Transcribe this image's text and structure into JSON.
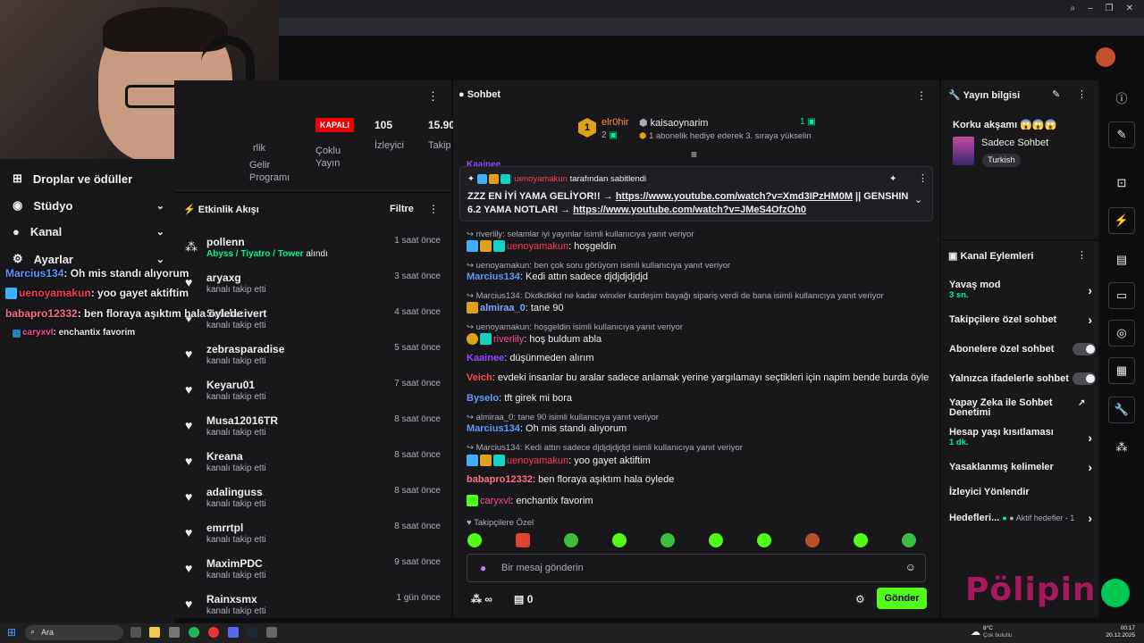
{
  "stats": {
    "items": [
      {
        "value": "",
        "label1": "rlik",
        "label2": ""
      },
      {
        "badge": "KAPALI",
        "label1": "Çoklu",
        "label2": "Yayın"
      },
      {
        "value": "105",
        "label1": "İzleyici",
        "label2": ""
      },
      {
        "value": "15.90",
        "label1": "Takip",
        "label2": ""
      }
    ],
    "gelir_label1": "Gelir",
    "gelir_label2": "Programı"
  },
  "left_menu": [
    {
      "label": "Droplar ve ödüller",
      "icon": "gift-icon"
    },
    {
      "label": "Stüdyo",
      "icon": "camera-icon"
    },
    {
      "label": "Kanal",
      "icon": "user-icon"
    },
    {
      "label": "Ayarlar",
      "icon": "gear-icon"
    }
  ],
  "overlay_chat": [
    {
      "user": "Marcius134",
      "text": ": Oh mis standı alıyorum",
      "color": "#5b9bff"
    },
    {
      "user": "uenoyamakun",
      "text": ": yoo gayet aktiftim",
      "color": "#ff3c5a"
    },
    {
      "user": "babapro12332",
      "text": ": ben floraya aşıktım hala öylede",
      "color": "#ff6e8a"
    },
    {
      "user": "caryxvl",
      "text": ": enchantix favorim",
      "color": "#ff4aa5"
    }
  ],
  "activity": {
    "title": "Etkinlik Akışı",
    "filter_label": "Filtre",
    "rows": [
      {
        "name": "pollenn",
        "sub": "Abyss / Tiyatro / Tower",
        "sub_suffix": " alındı",
        "time": "1 saat önce"
      },
      {
        "name": "aryaxg",
        "sub": "kanalı takip etti",
        "time": "3 saat önce"
      },
      {
        "name": "Sefalacivert",
        "sub": "kanalı takip etti",
        "time": "4 saat önce"
      },
      {
        "name": "zebrasparadise",
        "sub": "kanalı takip etti",
        "time": "5 saat önce"
      },
      {
        "name": "Keyaru01",
        "sub": "kanalı takip etti",
        "time": "7 saat önce"
      },
      {
        "name": "Musa12016TR",
        "sub": "kanalı takip etti",
        "time": "8 saat önce"
      },
      {
        "name": "Kreana",
        "sub": "kanalı takip etti",
        "time": "8 saat önce"
      },
      {
        "name": "adalinguss",
        "sub": "kanalı takip etti",
        "time": "8 saat önce"
      },
      {
        "name": "emrrtpl",
        "sub": "kanalı takip etti",
        "time": "8 saat önce"
      },
      {
        "name": "MaximPDC",
        "sub": "kanalı takip etti",
        "time": "9 saat önce"
      },
      {
        "name": "Rainxsmx",
        "sub": "kanalı takip etti",
        "time": "1 gün önce"
      }
    ]
  },
  "chat": {
    "title": "Sohbet",
    "leader": {
      "rank": "1",
      "user": "elr0hir",
      "count": "2",
      "gifter": "kaisaoynarim",
      "gift_count": "1",
      "gift_text": "1 abonelik hediye ederek 3. sıraya yükselin"
    },
    "partial_user": "Kaainee",
    "pinned": {
      "by_user": "uenoyamakun",
      "by_text": "tarafından sabitlendi",
      "text1": "ZZZ EN İYİ YAMA GELİYOR!! → ",
      "link1": "https://www.youtube.com/watch?v=Xmd3IPzHM0M",
      "text2": " || GENSHIN",
      "text3": "6.2 YAMA NOTLARI → ",
      "link2": "https://www.youtube.com/watch?v=JMeS4OfzOh0"
    },
    "messages": [
      {
        "reply": "riverlily: selamlar iyi yayınlar isimli kullanıcıya yanıt veriyor",
        "user": "uenoyamakun",
        "color": "#ff3c5a",
        "text": ": hoşgeldin",
        "badges": 3
      },
      {
        "reply": "uenoyamakun: ben çok soru görüyom isimli kullanıcıya yanıt veriyor",
        "user": "Marcius134",
        "color": "#5b9bff",
        "text": ": Kedi attın sadece djdjdjdjdjd",
        "badges": 0
      },
      {
        "reply": "Marcius134: Dkdkdkkd ne kadar winxler kardeşim bayağı sipariş verdi de bana isimli kullanıcıya yanıt veriyor",
        "user": "almiraa_0",
        "color": "#7fa7ff",
        "text": ": tane 90",
        "badges": 1
      },
      {
        "reply": "uenoyamakun: hoşgeldin isimli kullanıcıya yanıt veriyor",
        "user": "riverlily",
        "color": "#ff4aa5",
        "text": ": hoş buldum abla",
        "badges": 2
      },
      {
        "reply": "",
        "user": "Kaainee",
        "color": "#9147ff",
        "text": ": düşünmeden alırım",
        "badges": 0
      },
      {
        "reply": "",
        "user": "Veich",
        "color": "#ff4a4a",
        "text": ": evdeki insanlar bu aralar sadece anlamak yerine yargılamayı seçtikleri için napim bende burda öyle",
        "badges": 0
      },
      {
        "reply": "",
        "user": "Byselo",
        "color": "#5b9bff",
        "text": ": tft girek mi bora",
        "badges": 0
      },
      {
        "reply": "almiraa_0: tane 90 isimli kullanıcıya yanıt veriyor",
        "user": "Marcius134",
        "color": "#5b9bff",
        "text": ": Oh mis standı alıyorum",
        "badges": 0
      },
      {
        "reply": "Marcius134: Kedi attın sadece djdjdjdjdjd isimli kullanıcıya yanıt veriyor",
        "user": "uenoyamakun",
        "color": "#ff3c5a",
        "text": ": yoo gayet aktiftim",
        "badges": 3
      },
      {
        "reply": "",
        "user": "babapro12332",
        "color": "#ff6e8a",
        "text": ": ben floraya aşıktım hala öylede",
        "badges": 0
      },
      {
        "reply": "",
        "user": "caryxvl",
        "color": "#ff4aa5",
        "text": ": enchantix favorim",
        "badges": 1
      }
    ],
    "emote_label": "Takipçilere Özel",
    "input_placeholder": "Bir mesaj gönderin",
    "points": "∞",
    "sub_count": "0",
    "send_label": "Gönder"
  },
  "stream_info": {
    "title": "Yayın bilgisi",
    "stream_title": "Korku akşamı 😱😱😱",
    "category": "Sadece Sohbet",
    "tag": "Turkish"
  },
  "channel_actions": {
    "title": "Kanal Eylemleri",
    "rows": [
      {
        "label": "Yavaş mod",
        "sub": "3 sn.",
        "control": "chevron"
      },
      {
        "label": "Takipçilere özel sohbet",
        "sub": "",
        "control": "chevron"
      },
      {
        "label": "Abonelere özel sohbet",
        "sub": "",
        "control": "toggle"
      },
      {
        "label": "Yalnızca ifadelerle sohbet",
        "sub": "",
        "control": "toggle"
      },
      {
        "label": "Yapay Zeka ile Sohbet Denetimi",
        "sub": "",
        "control": "external"
      },
      {
        "label": "Hesap yaşı kısıtlaması",
        "sub": "1 dk.",
        "control": "chevron"
      },
      {
        "label": "Yasaklanmış kelimeler",
        "sub": "",
        "control": "chevron"
      },
      {
        "label": "İzleyici Yönlendir",
        "sub": "",
        "control": "none"
      },
      {
        "label": "Hedefleri...",
        "sub": "",
        "control": "chevron",
        "extra": "● Aktif hedefler - 1"
      }
    ]
  },
  "taskbar": {
    "search_placeholder": "Ara",
    "weather_temp": "8°C",
    "weather_text": "Çok bulutlu",
    "time": "00:17",
    "date": "20.12.2025"
  },
  "watermark": "Pölipin",
  "colors": {
    "accent_green": "#00f593",
    "kapali_red": "#eb0400",
    "panel": "#18181b",
    "bg": "#0e0e10"
  }
}
